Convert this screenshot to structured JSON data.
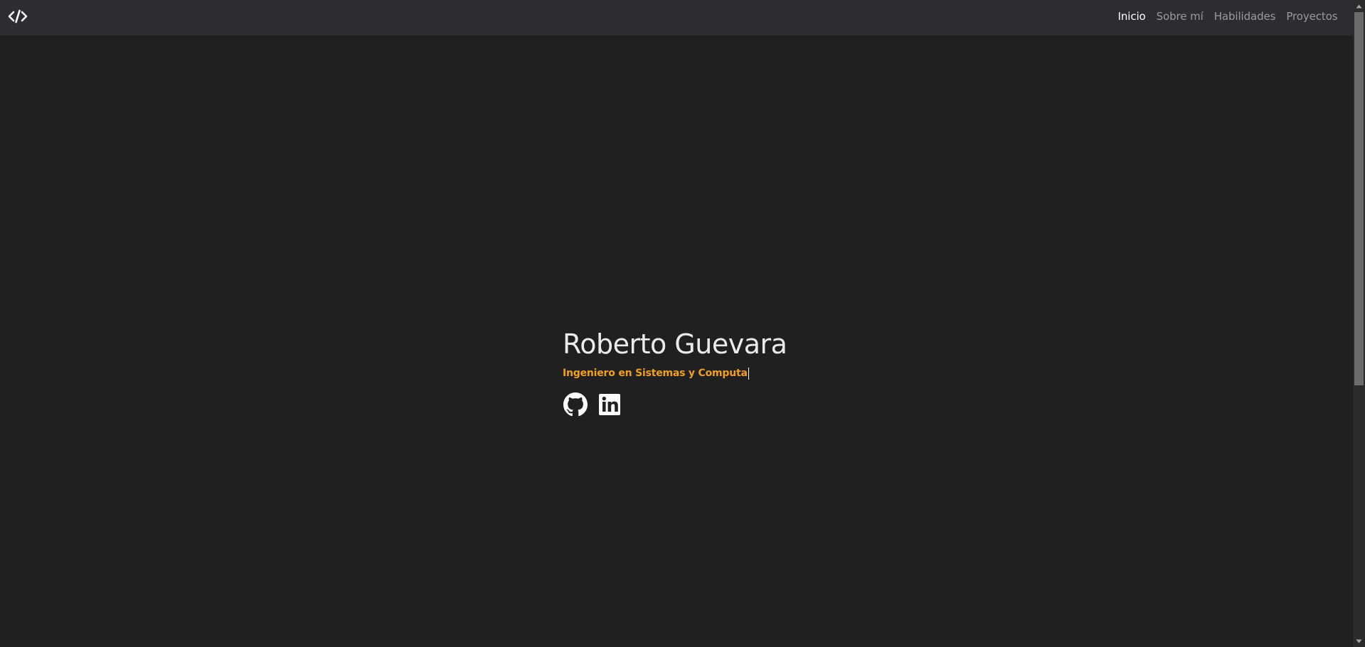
{
  "navbar": {
    "brand_icon": "code-icon",
    "links": [
      {
        "label": "Inicio",
        "active": true
      },
      {
        "label": "Sobre mí",
        "active": false
      },
      {
        "label": "Habilidades",
        "active": false
      },
      {
        "label": "Proyectos",
        "active": false
      }
    ]
  },
  "hero": {
    "name": "Roberto Guevara",
    "subtitle": "Ingeniero en Sistemas y Computa",
    "social": [
      {
        "icon": "github-icon"
      },
      {
        "icon": "linkedin-icon"
      }
    ]
  },
  "colors": {
    "background": "#202020",
    "navbar": "#2b2d31",
    "accent": "#f0a01e",
    "text": "#ebebeb",
    "nav_inactive": "#9a9b9e"
  }
}
